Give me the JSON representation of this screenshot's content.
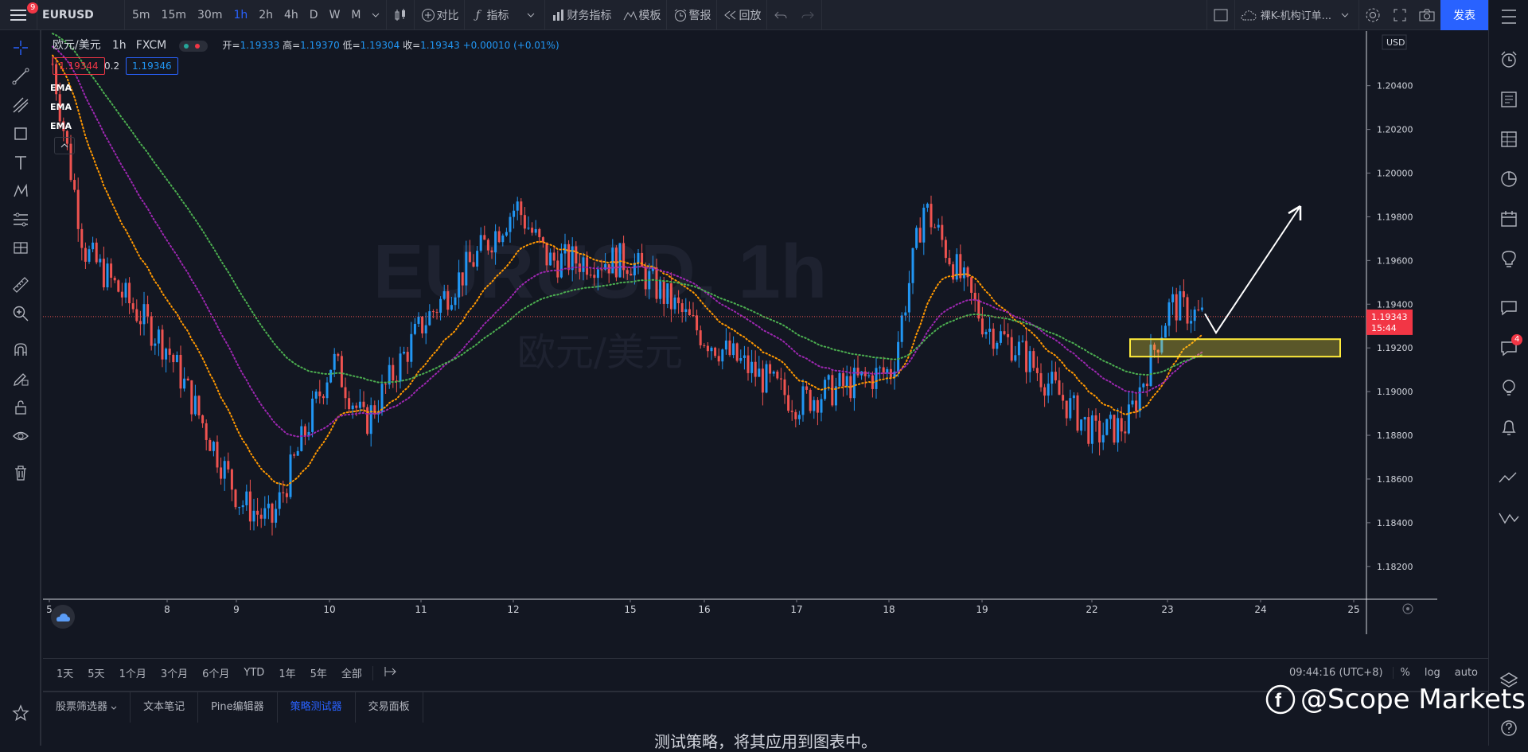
{
  "topbar": {
    "menu_badge": "9",
    "symbol": "EURUSD",
    "timeframes": [
      "5m",
      "15m",
      "30m",
      "1h",
      "2h",
      "4h",
      "D",
      "W",
      "M"
    ],
    "active_timeframe": "1h",
    "compare": "对比",
    "indicators": "指标",
    "financials": "财务指标",
    "templates": "模板",
    "alert": "警报",
    "replay": "回放",
    "layout_name": "裸K-机构订单...",
    "publish": "发表"
  },
  "legend": {
    "name": "欧元/美元",
    "interval": "1h",
    "source": "FXCM",
    "open_label": "开=",
    "open": "1.19333",
    "high_label": "高=",
    "high": "1.19370",
    "low_label": "低=",
    "low": "1.19304",
    "close_label": "收=",
    "close": "1.19343",
    "change": "+0.00010 (+0.01%)",
    "bid": "1.19344",
    "spread": "0.2",
    "ask": "1.19346",
    "indicators": [
      "EMA",
      "EMA",
      "EMA"
    ]
  },
  "chart_data": {
    "type": "candlestick",
    "symbol_watermark": "EURUSD, 1h",
    "watermark_sub": "欧元/美元",
    "y_axis_unit": "USD",
    "y_ticks": [
      "1.20400",
      "1.20200",
      "1.20000",
      "1.19800",
      "1.19600",
      "1.19400",
      "1.19200",
      "1.19000",
      "1.18800",
      "1.18600",
      "1.18400",
      "1.18200"
    ],
    "ylim": [
      1.1805,
      1.2065
    ],
    "x_ticks": [
      "5",
      "8",
      "9",
      "10",
      "11",
      "12",
      "15",
      "16",
      "17",
      "18",
      "19",
      "22",
      "23",
      "24",
      "25"
    ],
    "current_price": "1.19343",
    "countdown": "15:44",
    "approx_path": [
      {
        "day": "5",
        "price": 1.205
      },
      {
        "day": "5",
        "price": 1.1965
      },
      {
        "day": "8",
        "price": 1.192
      },
      {
        "day": "9",
        "price": 1.185
      },
      {
        "day": "9",
        "price": 1.184
      },
      {
        "day": "10",
        "price": 1.1915
      },
      {
        "day": "10",
        "price": 1.1885
      },
      {
        "day": "11",
        "price": 1.193
      },
      {
        "day": "12",
        "price": 1.1985
      },
      {
        "day": "12",
        "price": 1.196
      },
      {
        "day": "15",
        "price": 1.196
      },
      {
        "day": "16",
        "price": 1.1925
      },
      {
        "day": "17",
        "price": 1.1895
      },
      {
        "day": "18",
        "price": 1.191
      },
      {
        "day": "18",
        "price": 1.1985
      },
      {
        "day": "19",
        "price": 1.193
      },
      {
        "day": "19",
        "price": 1.192
      },
      {
        "day": "22",
        "price": 1.188
      },
      {
        "day": "22",
        "price": 1.1885
      },
      {
        "day": "23",
        "price": 1.194
      },
      {
        "day": "23",
        "price": 1.1934
      }
    ],
    "ema_colors": {
      "fast": "#ff9800",
      "mid": "#9c27b0",
      "slow": "#4caf50"
    },
    "candle_colors": {
      "up": "#2196f3",
      "down": "#ef5350"
    },
    "annotations": {
      "zone": {
        "price_low": 1.1916,
        "price_high": 1.1924,
        "color": "#ffeb3b"
      },
      "arrow": "up"
    }
  },
  "bottombar": {
    "ranges": [
      "1天",
      "5天",
      "1个月",
      "3个月",
      "6个月",
      "YTD",
      "1年",
      "5年",
      "全部"
    ],
    "time": "09:44:16 (UTC+8)",
    "pct": "%",
    "log": "log",
    "auto": "auto"
  },
  "panel": {
    "tabs": [
      "股票筛选器",
      "文本笔记",
      "Pine编辑器",
      "策略测试器",
      "交易面板"
    ],
    "active_tab": "策略测试器",
    "message": "测试策略，将其应用到图表中。"
  },
  "watermark": "@Scope Markets",
  "right_badge": "4"
}
